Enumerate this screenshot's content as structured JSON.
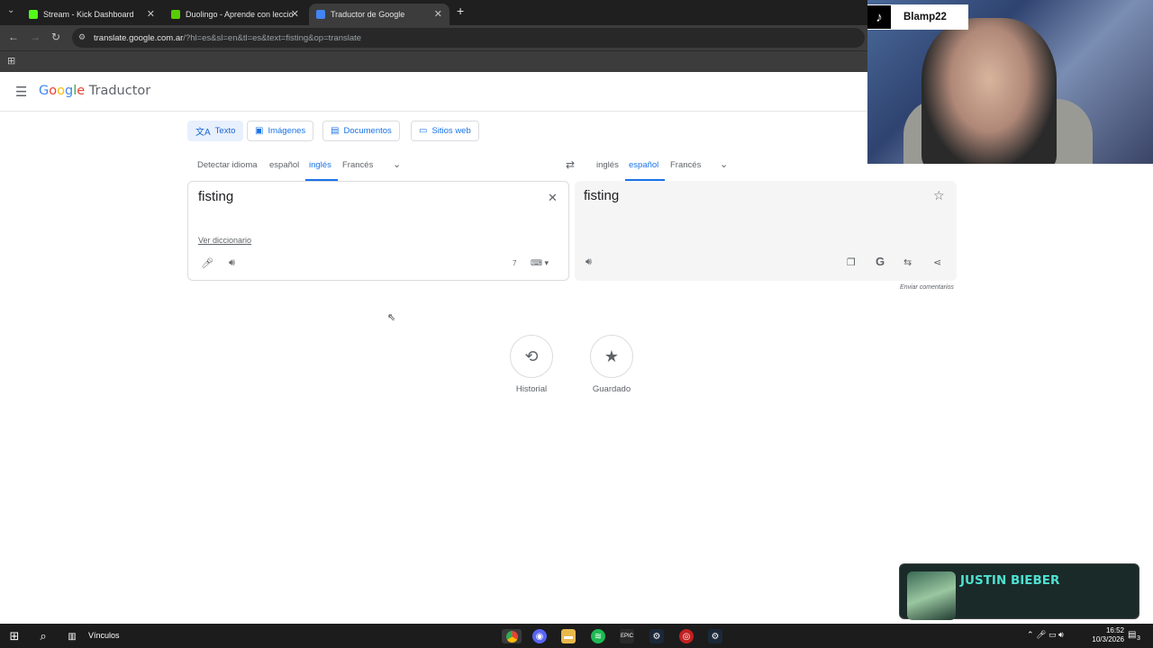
{
  "browser": {
    "tabs": [
      {
        "title": "Stream - Kick Dashboard",
        "favicon_color": "#53fc18"
      },
      {
        "title": "Duolingo - Aprende con leccio",
        "favicon_color": "#58cc02"
      },
      {
        "title": "Traductor de Google",
        "favicon_color": "#4285f4"
      }
    ],
    "new_tab": "+",
    "url_host": "translate.google.com.ar",
    "url_rest": "/?hl=es&sl=en&tl=es&text=fisting&op=translate"
  },
  "header": {
    "menu_icon": "hamburger-icon",
    "logo_google": "Google",
    "logo_product": "Traductor"
  },
  "type_tabs": [
    {
      "label": "Texto",
      "icon": "translate-icon",
      "active": true
    },
    {
      "label": "Imágenes",
      "icon": "image-icon"
    },
    {
      "label": "Documentos",
      "icon": "document-icon"
    },
    {
      "label": "Sitios web",
      "icon": "website-icon"
    }
  ],
  "source_langs": [
    "Detectar idioma",
    "español",
    "inglés",
    "Francés"
  ],
  "source_selected": "inglés",
  "target_langs": [
    "inglés",
    "español",
    "Francés"
  ],
  "target_selected": "español",
  "source": {
    "text": "fisting",
    "dictionary_link": "Ver diccionario",
    "char_count": "7"
  },
  "target": {
    "text": "fisting",
    "feedback": "Enviar comentarios"
  },
  "shortcuts": [
    {
      "label": "Historial",
      "icon": "history-icon"
    },
    {
      "label": "Guardado",
      "icon": "star-icon"
    }
  ],
  "overlay": {
    "tiktok_user": "Blamp22",
    "now_playing": "JUSTIN BIEBER"
  },
  "taskbar": {
    "links_label": "Vínculos",
    "time": "16:52",
    "date": "10/3/2026",
    "notification_count": "3"
  },
  "colors": {
    "accent": "#1a73e8",
    "chrome_dark": "#1f1f1f",
    "taskbar": "#1c1c1c"
  }
}
